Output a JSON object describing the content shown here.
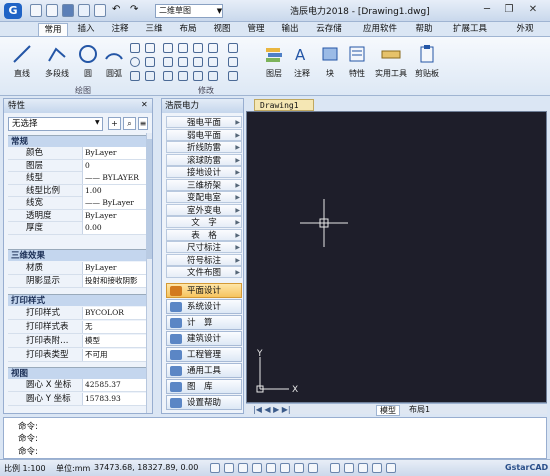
{
  "titlebar": {
    "workspace": "二维草图",
    "title": "浩辰电力2018 - [Drawing1.dwg]",
    "minimize": "─",
    "restore": "❐",
    "close": "✕",
    "ribbon_right": "外观"
  },
  "menu_tabs": [
    "常用",
    "插入",
    "注释",
    "三维",
    "布局",
    "视图",
    "管理",
    "输出",
    "云存储",
    "应用软件",
    "帮助",
    "扩展工具"
  ],
  "ribbon": {
    "draw_group": "绘图",
    "modify_group": "修改",
    "buttons": [
      "直线",
      "多段线",
      "圆",
      "圆弧",
      "图层",
      "注释",
      "块",
      "特性",
      "实用工具",
      "剪贴板"
    ]
  },
  "properties": {
    "title": "特性",
    "selection": "无选择",
    "sections": [
      {
        "name": "常规",
        "rows": [
          [
            "颜色",
            "ByLayer"
          ],
          [
            "图层",
            "0"
          ],
          [
            "线型",
            "—— BYLAYER"
          ],
          [
            "线型比例",
            "1.00"
          ],
          [
            "线宽",
            "—— ByLayer"
          ],
          [
            "透明度",
            "ByLayer"
          ],
          [
            "厚度",
            "0.00"
          ]
        ]
      },
      {
        "name": "三维效果",
        "rows": [
          [
            "材质",
            "ByLayer"
          ],
          [
            "阴影显示",
            "投射和接收阴影"
          ]
        ]
      },
      {
        "name": "打印样式",
        "rows": [
          [
            "打印样式",
            "BYCOLOR"
          ],
          [
            "打印样式表",
            "无"
          ],
          [
            "打印表附…",
            "模型"
          ],
          [
            "打印表类型",
            "不可用"
          ]
        ]
      },
      {
        "name": "视图",
        "rows": [
          [
            "圆心 X 坐标",
            "42585.37"
          ],
          [
            "圆心 Y 坐标",
            "15783.93"
          ]
        ]
      }
    ]
  },
  "tools": {
    "title": "浩辰电力",
    "items": [
      "强电平面",
      "弱电平面",
      "折线防雷",
      "滚球防雷",
      "接地设计",
      "三维桥架",
      "变配电室",
      "室外变电",
      "文　字",
      "表　格",
      "尺寸标注",
      "符号标注",
      "文件布图"
    ],
    "categories": [
      "平面设计",
      "系统设计",
      "计　算",
      "建筑设计",
      "工程管理",
      "通用工具",
      "图　库",
      "设置帮助"
    ]
  },
  "drawing": {
    "tab": "Drawing1",
    "nav": "|◀ ◀ ▶ ▶|",
    "layout_tabs": [
      "模型",
      "布局1"
    ]
  },
  "command": {
    "lines": [
      "命令:",
      "命令:",
      "命令:"
    ]
  },
  "status": {
    "scale": "比例 1:100",
    "units": "单位:mm",
    "coords": "37473.68, 18327.89, 0.00",
    "brand": "GstarCAD"
  }
}
